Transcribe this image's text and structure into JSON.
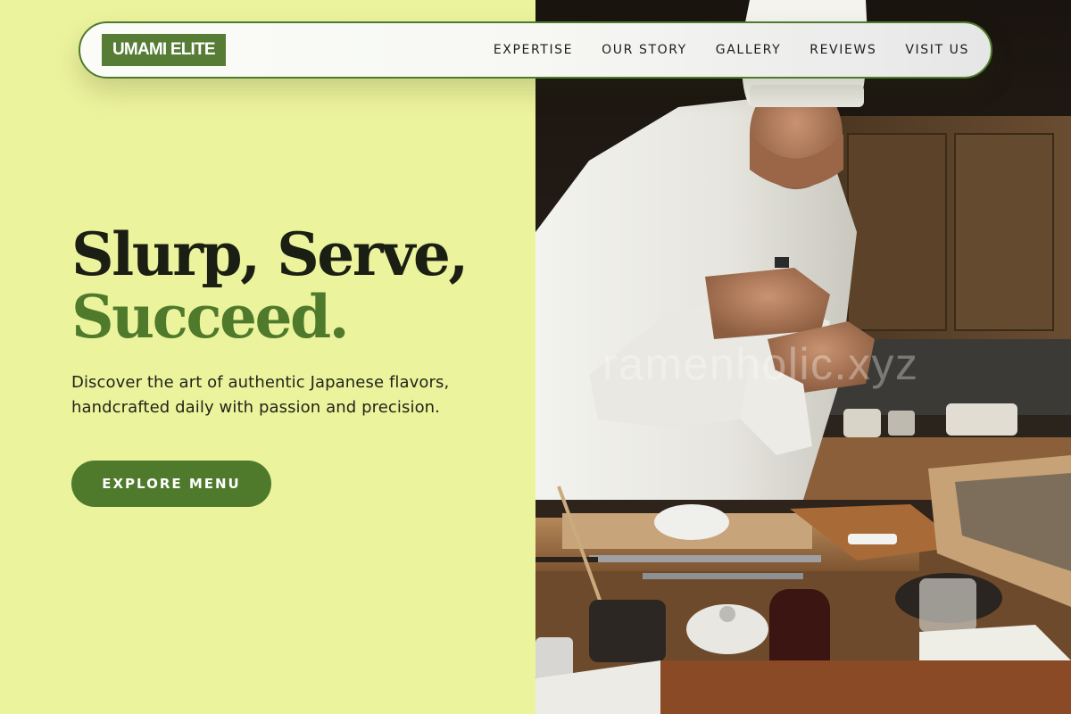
{
  "brand": {
    "logo_text": "UMAMI ELITE"
  },
  "nav": {
    "items": [
      {
        "label": "EXPERTISE"
      },
      {
        "label": "OUR STORY"
      },
      {
        "label": "GALLERY"
      },
      {
        "label": "REVIEWS"
      },
      {
        "label": "VISIT US"
      }
    ]
  },
  "hero": {
    "title_line1": "Slurp, Serve,",
    "title_line2": "Succeed.",
    "description": "Discover the art of authentic Japanese flavors, handcrafted daily with passion and precision.",
    "cta_label": "EXPLORE MENU"
  },
  "photo": {
    "watermark": "ramenholic.xyz",
    "subject": "sushi chef preparing nigiri at wooden counter"
  },
  "colors": {
    "background": "#ecf39d",
    "accent_green": "#4f7a2c",
    "logo_green": "#577c35",
    "title_dark": "#1b1f13"
  }
}
